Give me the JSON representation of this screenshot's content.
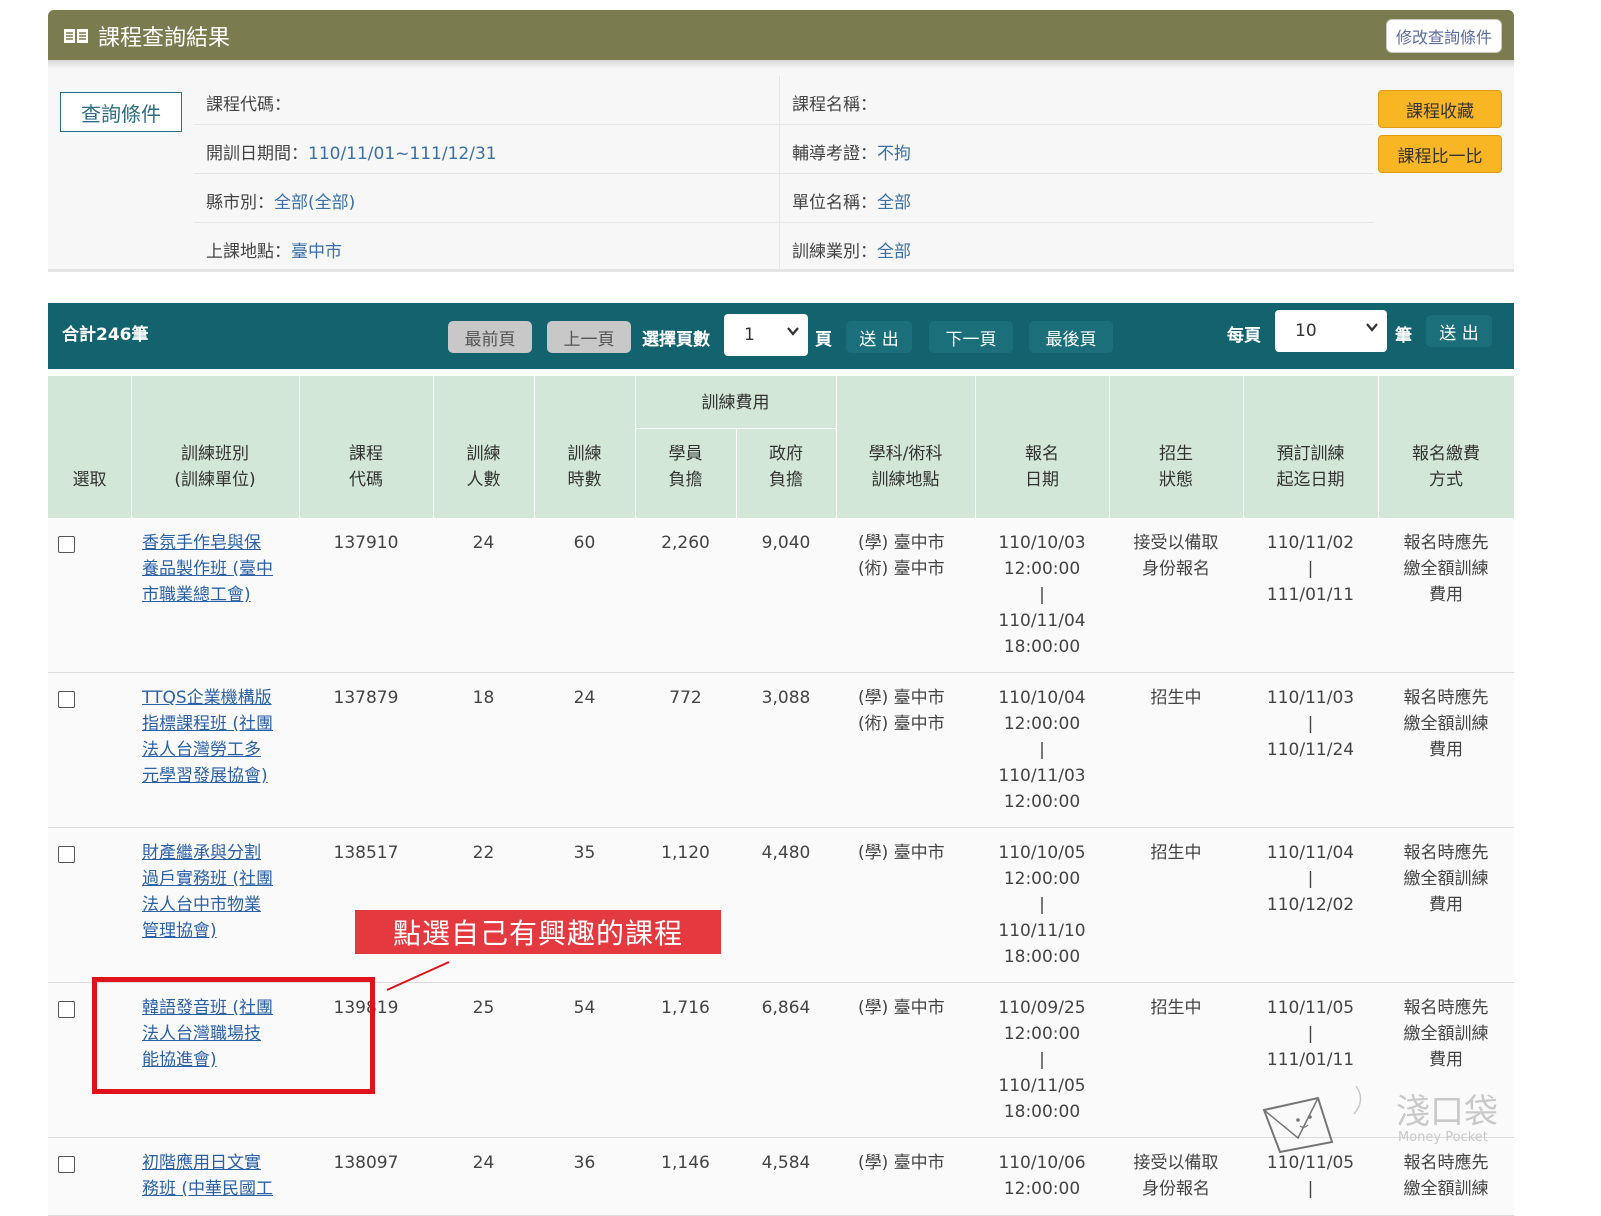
{
  "header": {
    "title": "課程查詢結果",
    "modify_button": "修改查詢條件"
  },
  "query": {
    "button": "查詢條件",
    "rows": [
      {
        "left_label": "課程代碼：",
        "left_value": "",
        "right_label": "課程名稱：",
        "right_value": ""
      },
      {
        "left_label": "開訓日期間：",
        "left_value": "110/11/01~111/12/31",
        "right_label": "輔導考證：",
        "right_value": "不拘"
      },
      {
        "left_label": "縣市別：",
        "left_value": "全部(全部)",
        "right_label": "單位名稱：",
        "right_value": "全部"
      },
      {
        "left_label": "上課地點：",
        "left_value": "臺中市",
        "right_label": "訓練業別：",
        "right_value": "全部"
      }
    ],
    "fav_button": "課程收藏",
    "compare_button": "課程比一比"
  },
  "pager": {
    "total": "合計246筆",
    "first": "最前頁",
    "prev": "上一頁",
    "select_page_label": "選擇頁數",
    "page_value": "1",
    "page_unit": "頁",
    "submit": "送 出",
    "next": "下一頁",
    "last": "最後頁",
    "per_page_label": "每頁",
    "per_page_value": "10",
    "per_page_unit": "筆",
    "submit2": "送 出"
  },
  "table": {
    "headers": {
      "select": "選取",
      "class": [
        "訓練班別",
        "(訓練單位)"
      ],
      "code": [
        "課程",
        "代碼"
      ],
      "people": [
        "訓練",
        "人數"
      ],
      "hours": [
        "訓練",
        "時數"
      ],
      "fee_group": "訓練費用",
      "student": [
        "學員",
        "負擔"
      ],
      "gov": [
        "政府",
        "負擔"
      ],
      "location": [
        "學科/術科",
        "訓練地點"
      ],
      "signup": [
        "報名",
        "日期"
      ],
      "status": [
        "招生",
        "狀態"
      ],
      "period": [
        "預訂訓練",
        "起迄日期"
      ],
      "payment": [
        "報名繳費",
        "方式"
      ]
    },
    "rows": [
      {
        "name": [
          "香氛手作皂與保",
          "養品製作班 (臺中",
          "市職業總工會)"
        ],
        "code": "137910",
        "people": "24",
        "hours": "60",
        "student": "2,260",
        "gov": "9,040",
        "location": [
          "(學) 臺中市",
          "(術) 臺中市"
        ],
        "signup": [
          "110/10/03",
          "12:00:00",
          "|",
          "110/11/04",
          "18:00:00"
        ],
        "status": [
          "接受以備取",
          "身份報名"
        ],
        "period": [
          "110/11/02",
          "|",
          "111/01/11"
        ],
        "payment": [
          "報名時應先",
          "繳全額訓練",
          "費用"
        ]
      },
      {
        "name": [
          "TTQS企業機構版",
          "指標課程班 (社團",
          "法人台灣勞工多",
          "元學習發展協會)"
        ],
        "code": "137879",
        "people": "18",
        "hours": "24",
        "student": "772",
        "gov": "3,088",
        "location": [
          "(學) 臺中市",
          "(術) 臺中市"
        ],
        "signup": [
          "110/10/04",
          "12:00:00",
          "|",
          "110/11/03",
          "12:00:00"
        ],
        "status": [
          "招生中"
        ],
        "period": [
          "110/11/03",
          "|",
          "110/11/24"
        ],
        "payment": [
          "報名時應先",
          "繳全額訓練",
          "費用"
        ]
      },
      {
        "name": [
          "財產繼承與分割",
          "過戶實務班 (社團",
          "法人台中市物業",
          "管理協會)"
        ],
        "code": "138517",
        "people": "22",
        "hours": "35",
        "student": "1,120",
        "gov": "4,480",
        "location": [
          "(學) 臺中市"
        ],
        "signup": [
          "110/10/05",
          "12:00:00",
          "|",
          "110/11/10",
          "18:00:00"
        ],
        "status": [
          "招生中"
        ],
        "period": [
          "110/11/04",
          "|",
          "110/12/02"
        ],
        "payment": [
          "報名時應先",
          "繳全額訓練",
          "費用"
        ]
      },
      {
        "name": [
          "韓語發音班 (社團",
          "法人台灣職場技",
          "能協進會)"
        ],
        "code": "139819",
        "people": "25",
        "hours": "54",
        "student": "1,716",
        "gov": "6,864",
        "location": [
          "(學) 臺中市"
        ],
        "signup": [
          "110/09/25",
          "12:00:00",
          "|",
          "110/11/05",
          "18:00:00"
        ],
        "status": [
          "招生中"
        ],
        "period": [
          "110/11/05",
          "|",
          "111/01/11"
        ],
        "payment": [
          "報名時應先",
          "繳全額訓練",
          "費用"
        ]
      },
      {
        "name": [
          "初階應用日文實",
          "務班 (中華民國工"
        ],
        "code": "138097",
        "people": "24",
        "hours": "36",
        "student": "1,146",
        "gov": "4,584",
        "location": [
          "(學) 臺中市"
        ],
        "signup": [
          "110/10/06",
          "12:00:00"
        ],
        "status": [
          "接受以備取",
          "身份報名"
        ],
        "period": [
          "110/11/05",
          "|"
        ],
        "payment": [
          "報名時應先",
          "繳全額訓練"
        ]
      }
    ]
  },
  "annotation": {
    "callout": "點選自己有興趣的課程"
  },
  "watermark": {
    "text": "淺口袋",
    "sub": "Money Pocket"
  }
}
